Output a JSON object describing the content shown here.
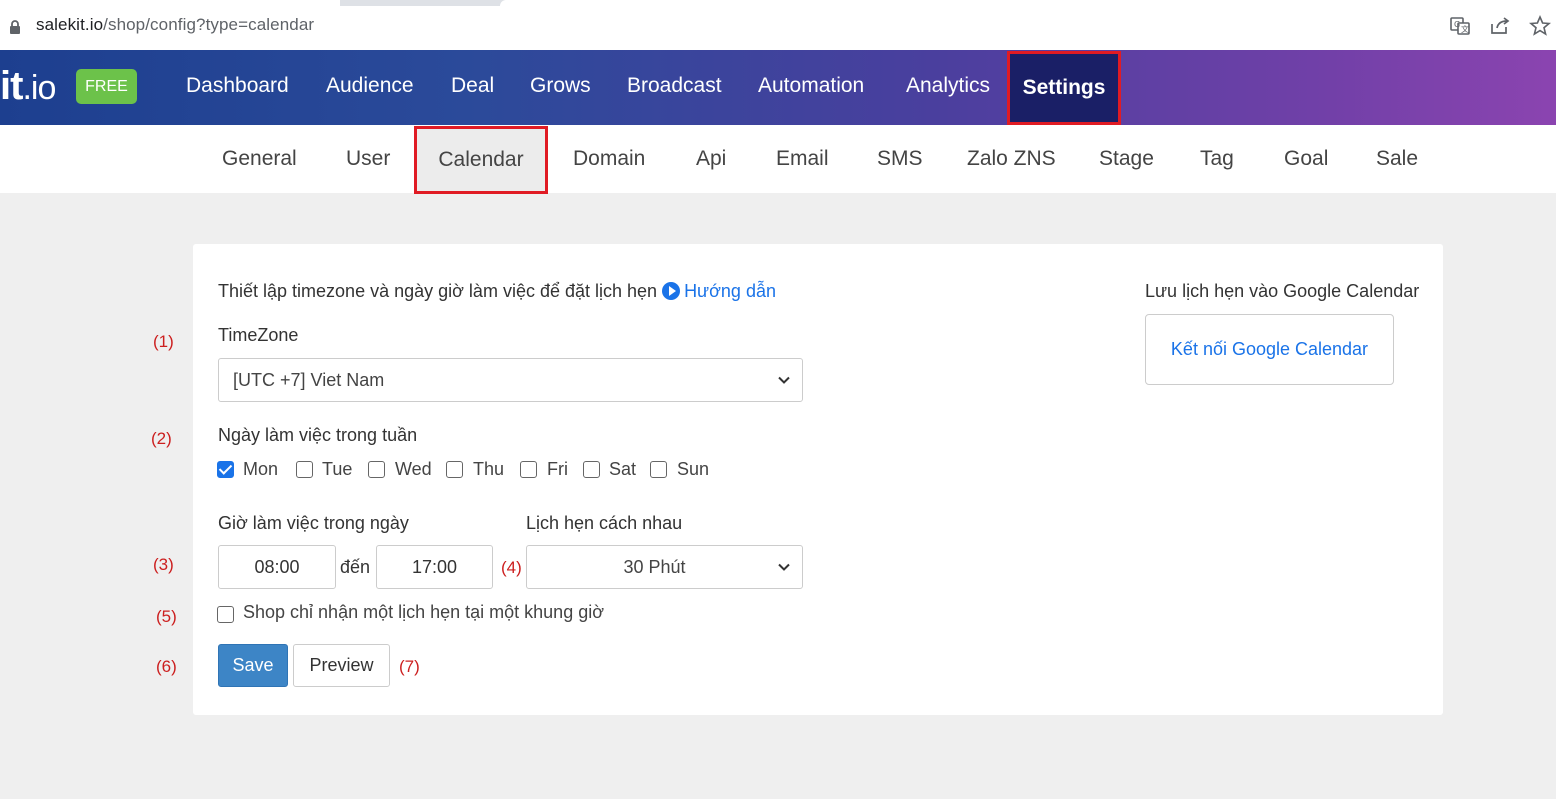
{
  "browser": {
    "url_host": "salekit.io",
    "url_path": "/shop/config?type=calendar"
  },
  "topnav": {
    "logo_main": "it",
    "logo_suffix": ".io",
    "plan_badge": "FREE",
    "items": [
      {
        "label": "Dashboard"
      },
      {
        "label": "Audience"
      },
      {
        "label": "Deal"
      },
      {
        "label": "Grows"
      },
      {
        "label": "Broadcast"
      },
      {
        "label": "Automation"
      },
      {
        "label": "Analytics"
      },
      {
        "label": "Settings",
        "active": true
      }
    ]
  },
  "subnav": {
    "items": [
      {
        "label": "General"
      },
      {
        "label": "User"
      },
      {
        "label": "Calendar",
        "active": true
      },
      {
        "label": "Domain"
      },
      {
        "label": "Api"
      },
      {
        "label": "Email"
      },
      {
        "label": "SMS"
      },
      {
        "label": "Zalo ZNS"
      },
      {
        "label": "Stage"
      },
      {
        "label": "Tag"
      },
      {
        "label": "Goal"
      },
      {
        "label": "Sale"
      }
    ]
  },
  "form": {
    "intro": "Thiết lập timezone và ngày giờ làm việc để đặt lịch hẹn",
    "guide_link": "Hướng dẫn",
    "timezone_label": "TimeZone",
    "timezone_value": "[UTC +7] Viet Nam",
    "workdays_label": "Ngày làm việc trong tuần",
    "days": [
      {
        "label": "Mon",
        "checked": true
      },
      {
        "label": "Tue",
        "checked": false
      },
      {
        "label": "Wed",
        "checked": false
      },
      {
        "label": "Thu",
        "checked": false
      },
      {
        "label": "Fri",
        "checked": false
      },
      {
        "label": "Sat",
        "checked": false
      },
      {
        "label": "Sun",
        "checked": false
      }
    ],
    "hours_label": "Giờ làm việc trong ngày",
    "start_time": "08:00",
    "to_word": "đến",
    "end_time": "17:00",
    "interval_label": "Lịch hẹn cách nhau",
    "interval_value": "30 Phút",
    "single_slot_label": "Shop chỉ nhận một lịch hẹn tại một khung giờ",
    "single_slot_checked": false,
    "save_label": "Save",
    "preview_label": "Preview"
  },
  "google": {
    "heading": "Lưu lịch hẹn vào Google Calendar",
    "connect_label": "Kết nối Google Calendar"
  },
  "annotations": [
    "(1)",
    "(2)",
    "(3)",
    "(4)",
    "(5)",
    "(6)",
    "(7)"
  ],
  "colors": {
    "highlight_border": "#e01b24",
    "link": "#1a73e8",
    "save_button": "#3d85c6",
    "free_badge": "#6cc24a"
  }
}
